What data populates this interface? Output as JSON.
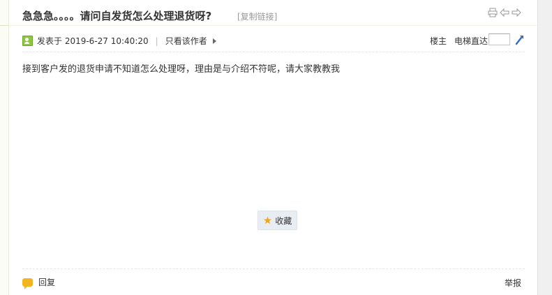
{
  "thread": {
    "title": "急急急。。。。请问自发货怎么处理退货呀?",
    "copy_link": "[复制链接]",
    "icons": [
      "print-icon",
      "prev-thread-icon",
      "next-thread-icon"
    ]
  },
  "post": {
    "posted_label": "发表于 2019-6-27 10:40:20",
    "only_author": "只看该作者",
    "floor": "楼主",
    "elevator": "电梯直达",
    "elevator_value": "",
    "content": "接到客户发的退货申请不知道怎么处理呀，理由是与介绍不符呢，请大家教教我",
    "favorite": "收藏",
    "reply": "回复",
    "report": "举报"
  },
  "colors": {
    "favorite_bg": "#e8edf3",
    "star": "#f1a41a",
    "reply_icon": "#f3b51f",
    "go_icon": "#3a6cc4"
  }
}
